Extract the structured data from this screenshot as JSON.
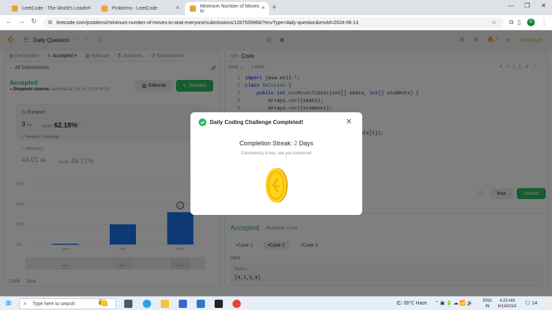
{
  "browser": {
    "tabs": [
      {
        "title": "LeetCode - The World's Leadin",
        "active": false
      },
      {
        "title": "Problems - LeetCode",
        "active": false
      },
      {
        "title": "Minimum Number of Moves to",
        "active": true
      }
    ],
    "url": "leetcode.com/problems/minimum-number-of-moves-to-seat-everyone/submissions/1287509968/?envType=daily-question&envId=2024-06-13",
    "profile_initial": "G"
  },
  "nav": {
    "daily_label": "Daily Question",
    "premium_label": "Premium",
    "streak_count": "2"
  },
  "left": {
    "tabs": [
      {
        "label": "Description"
      },
      {
        "label": "Accepted"
      },
      {
        "label": "Editorial"
      },
      {
        "label": "Solutions"
      },
      {
        "label": "Submissions"
      }
    ],
    "all_submissions": "All Submissions",
    "status": "Accepted",
    "submitter_name": "Divyanshi sharma",
    "submitted_at": "submitted at Jun 14, 2024 04:23",
    "editorial_btn": "Editorial",
    "solution_btn": "Solution",
    "runtime": {
      "label": "Runtime",
      "value": "3",
      "unit": "ms",
      "beats_label": "Beats",
      "beats": "62.18%"
    },
    "analyze": "Analyze Complexity",
    "memory": {
      "label": "Memory",
      "value": "44.01",
      "unit": "MB",
      "beats_label": "Beats",
      "beats": "49.17%"
    },
    "footer": {
      "code": "Code",
      "lang": "Java"
    }
  },
  "chart_data": {
    "type": "bar",
    "categories": [
      "1ms",
      "2ms",
      "3ms"
    ],
    "values": [
      1,
      25,
      40
    ],
    "y_ticks": [
      "75%",
      "50%",
      "25%",
      "0%"
    ],
    "ylim": [
      0,
      75
    ],
    "overview_labels": [
      "1ms",
      "2ms",
      "3ms"
    ],
    "bar_color": "#1a73e8",
    "highlight": "3ms"
  },
  "right": {
    "code_label": "Code",
    "language": "Java",
    "mode": "Auto",
    "code_lines": [
      {
        "n": "1",
        "text": "import java.util.*;"
      },
      {
        "n": "2",
        "text": "class Solution {"
      },
      {
        "n": "3",
        "text": "    public int minMovesToSeat(int[] seats, int[] students) {"
      },
      {
        "n": "4",
        "text": "        Arrays.sort(seats);"
      },
      {
        "n": "5",
        "text": "        Arrays.sort(students);"
      }
    ],
    "partial_code": [
      {
        "text": "}"
      },
      {
        "text": "nts[i]);"
      }
    ],
    "run_btn": "Run",
    "submit_btn": "Submit",
    "result": {
      "status": "Accepted",
      "runtime": "Runtime: 0 ms"
    },
    "cases": [
      {
        "label": "Case 1"
      },
      {
        "label": "Case 2"
      },
      {
        "label": "Case 3"
      }
    ],
    "input_label": "Input",
    "input_var": "seats =",
    "input_value": "[4,1,5,9]"
  },
  "modal": {
    "title": "Daily Coding Challenge Completed!",
    "streak_label": "Completion Streak:",
    "streak_value": "2",
    "streak_unit": "Days",
    "subtitle": "Consistency is key, see you tomorrow!"
  },
  "taskbar": {
    "search_placeholder": "Type here to search",
    "weather": "39°C  Haze",
    "lang1": "ENG",
    "lang2": "IN",
    "time": "4:23 AM",
    "date": "6/14/2024",
    "notification_count": "14"
  },
  "colors": {
    "accent_green": "#2cbb5d",
    "chart_blue": "#1a73e8",
    "premium_gold": "#d69e26"
  }
}
